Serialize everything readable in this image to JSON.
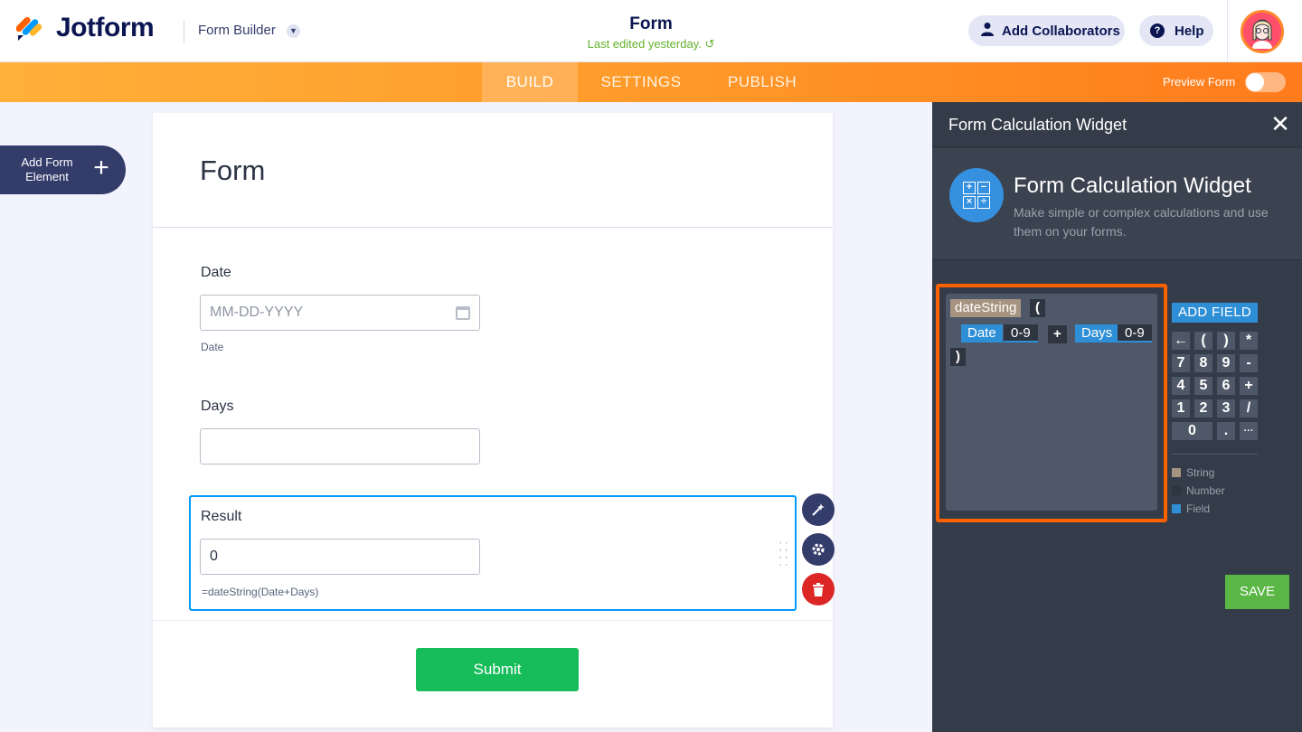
{
  "header": {
    "brand": "Jotform",
    "form_builder_label": "Form Builder",
    "form_title": "Form",
    "last_edited": "Last edited yesterday.",
    "add_collaborators": "Add Collaborators",
    "help": "Help"
  },
  "nav": {
    "tabs": [
      "BUILD",
      "SETTINGS",
      "PUBLISH"
    ],
    "active_tab": "BUILD",
    "preview_label": "Preview Form",
    "preview_on": false
  },
  "sidebar": {
    "add_element_label": "Add Form Element"
  },
  "form": {
    "title": "Form",
    "fields": [
      {
        "label": "Date",
        "placeholder": "MM-DD-YYYY",
        "sublabel": "Date"
      },
      {
        "label": "Days",
        "value": ""
      },
      {
        "label": "Result",
        "value": "0",
        "formula": "=dateString(Date+Days)"
      }
    ],
    "submit_label": "Submit"
  },
  "panel": {
    "title": "Form Calculation Widget",
    "widget_name": "Form Calculation Widget",
    "widget_desc": "Make simple or complex calculations and use them on your forms.",
    "editor": {
      "function_name": "dateString",
      "open_paren": "(",
      "close_paren": ")",
      "field1": "Date",
      "field1_range": "0-9",
      "operator": "+",
      "field2": "Days",
      "field2_range": "0-9"
    },
    "add_field_label": "ADD FIELD",
    "keypad": {
      "row1": [
        "←",
        "(",
        ")",
        "*"
      ],
      "row2": [
        "7",
        "8",
        "9",
        "-"
      ],
      "row3": [
        "4",
        "5",
        "6",
        "+"
      ],
      "row4": [
        "1",
        "2",
        "3",
        "/"
      ],
      "row5": [
        "0",
        ".",
        "···"
      ]
    },
    "legend": [
      {
        "label": "String",
        "color": "#a79480"
      },
      {
        "label": "Number",
        "color": "#2f3540"
      },
      {
        "label": "Field",
        "color": "#2f8fd6"
      }
    ],
    "save_label": "SAVE"
  },
  "colors": {
    "accent_orange": "#ff7b1c",
    "submit_green": "#18bd5b",
    "save_green": "#5ab645",
    "delete_red": "#dc2626",
    "highlight_frame": "#ff6100"
  }
}
